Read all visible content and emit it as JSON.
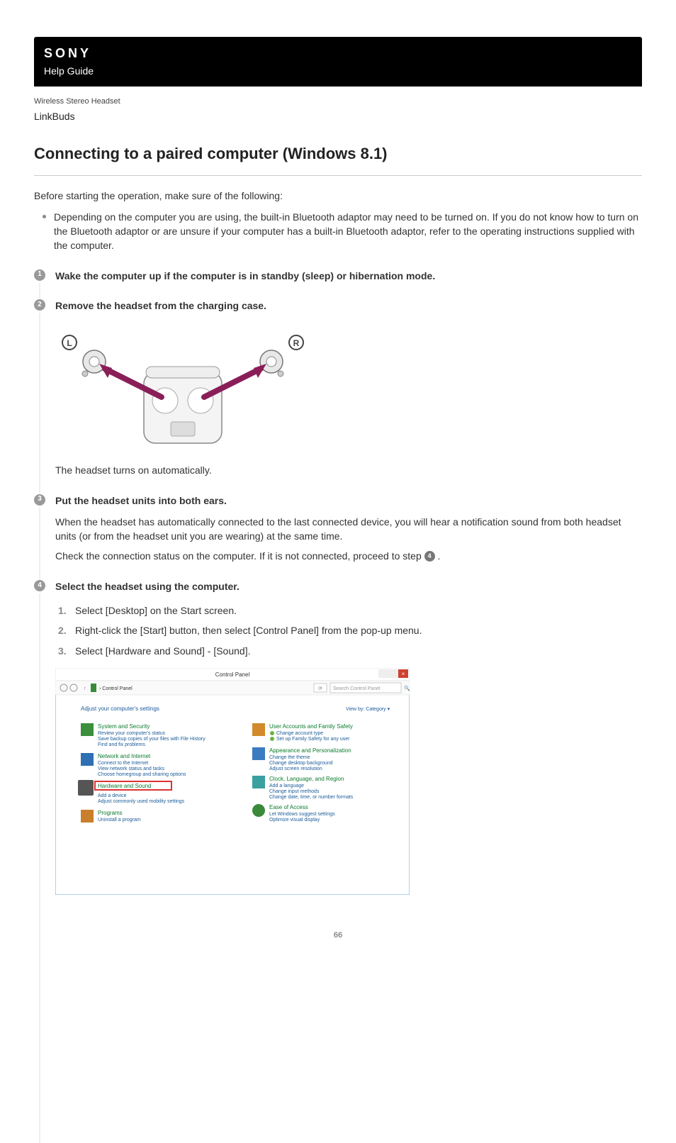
{
  "header": {
    "logo": "SONY",
    "help_guide": "Help Guide"
  },
  "product": {
    "type": "Wireless Stereo Headset",
    "name": "LinkBuds"
  },
  "title": "Connecting to a paired computer (Windows 8.1)",
  "intro": "Before starting the operation, make sure of the following:",
  "bullet": "Depending on the computer you are using, the built-in Bluetooth adaptor may need to be turned on. If you do not know how to turn on the Bluetooth adaptor or are unsure if your computer has a built-in Bluetooth adaptor, refer to the operating instructions supplied with the computer.",
  "steps": {
    "s1": {
      "num": "1",
      "head": "Wake the computer up if the computer is in standby (sleep) or hibernation mode."
    },
    "s2": {
      "num": "2",
      "head": "Remove the headset from the charging case.",
      "after_img": "The headset turns on automatically."
    },
    "s3": {
      "num": "3",
      "head": "Put the headset units into both ears.",
      "p1": "When the headset has automatically connected to the last connected device, you will hear a notification sound from both headset units (or from the headset unit you are wearing) at the same time.",
      "p2a": "Check the connection status on the computer. If it is not connected, proceed to step ",
      "p2b": " .",
      "ref": "4"
    },
    "s4": {
      "num": "4",
      "head": "Select the headset using the computer.",
      "sub1": "Select [Desktop] on the Start screen.",
      "sub2": "Right-click the [Start] button, then select [Control Panel] from the pop-up menu.",
      "sub3": "Select [Hardware and Sound] - [Sound]."
    }
  },
  "illustration": {
    "left_label": "L",
    "right_label": "R"
  },
  "control_panel": {
    "window_title": "Control Panel",
    "breadcrumb": "Control Panel",
    "search_placeholder": "Search Control Panel",
    "adjust_label": "Adjust your computer's settings",
    "view_by_label": "View by:",
    "view_by_value": "Category",
    "categories": [
      {
        "title": "System and Security",
        "links": [
          "Review your computer's status",
          "Save backup copies of your files with File History",
          "Find and fix problems"
        ]
      },
      {
        "title": "Network and Internet",
        "links": [
          "Connect to the Internet",
          "View network status and tasks",
          "Choose homegroup and sharing options"
        ]
      },
      {
        "title": "Hardware and Sound",
        "links": [
          "Add a device",
          "Adjust commonly used mobility settings"
        ],
        "highlighted": true
      },
      {
        "title": "Programs",
        "links": [
          "Uninstall a program"
        ]
      },
      {
        "title": "User Accounts and Family Safety",
        "links": [
          "Change account type",
          "Set up Family Safety for any user"
        ]
      },
      {
        "title": "Appearance and Personalization",
        "links": [
          "Change the theme",
          "Change desktop background",
          "Adjust screen resolution"
        ]
      },
      {
        "title": "Clock, Language, and Region",
        "links": [
          "Add a language",
          "Change input methods",
          "Change date, time, or number formats"
        ]
      },
      {
        "title": "Ease of Access",
        "links": [
          "Let Windows suggest settings",
          "Optimize visual display"
        ]
      }
    ]
  },
  "page_number": "66"
}
